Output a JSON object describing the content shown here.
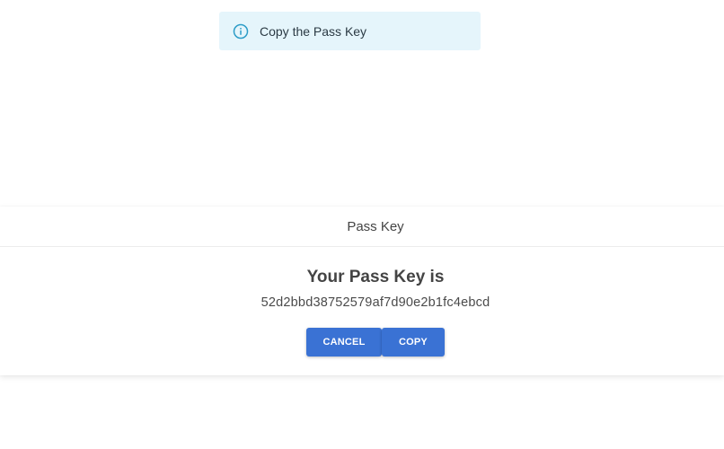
{
  "alert": {
    "icon": "info-icon",
    "text": "Copy the Pass Key",
    "accent_color": "#2c9cc7"
  },
  "dialog": {
    "header_title": "Pass Key",
    "body_title": "Your Pass Key is",
    "pass_key": "52d2bbd38752579af7d90e2b1fc4ebcd",
    "cancel_label": "CANCEL",
    "copy_label": "COPY",
    "button_color": "#3a72d4"
  }
}
